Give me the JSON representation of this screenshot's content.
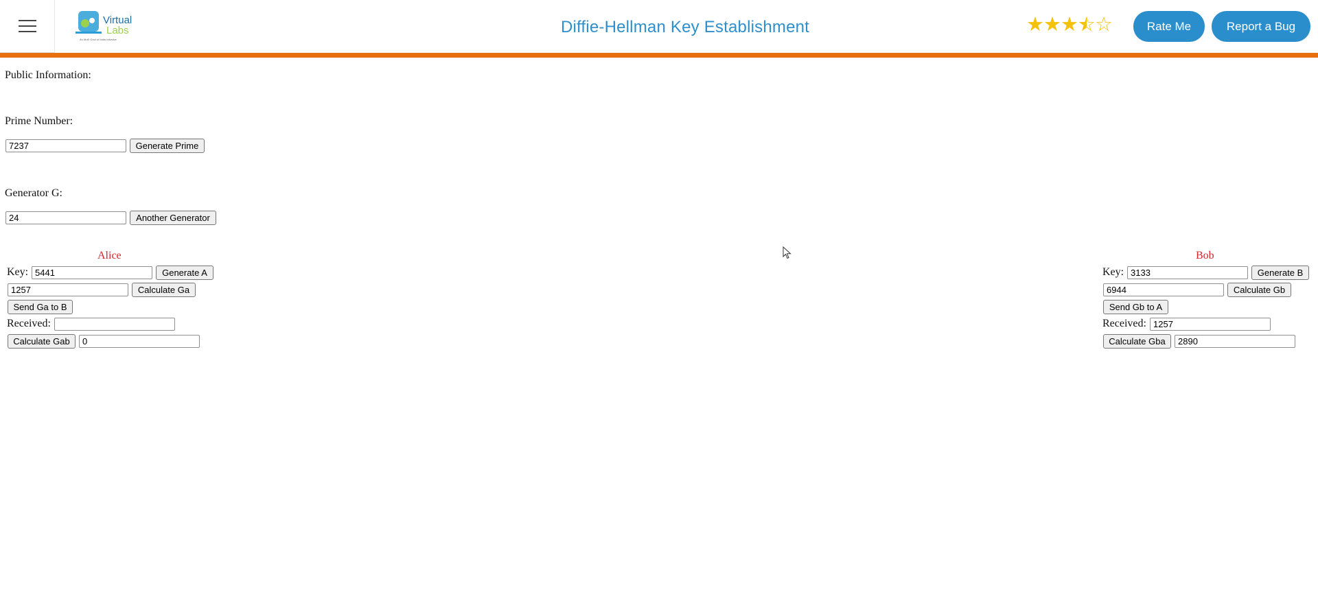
{
  "header": {
    "title": "Diffie-Hellman Key Establishment",
    "logo_line1": "Virtual",
    "logo_line2": "Labs",
    "logo_tagline": "An MoE Govt of India Initiative",
    "rating": 3.5,
    "rating_max": 5,
    "rate_label": "Rate Me",
    "bug_label": "Report a Bug",
    "accent_color": "#2e8fcc",
    "bar_color": "#e8710f"
  },
  "public": {
    "heading": "Public Information:",
    "prime_label": "Prime Number:",
    "prime_value": "7237",
    "prime_button": "Generate Prime",
    "generator_label": "Generator G:",
    "generator_value": "24",
    "generator_button": "Another Generator"
  },
  "alice": {
    "name": "Alice",
    "key_label": "Key:",
    "key_value": "5441",
    "generate_button": "Generate A",
    "g_value": "1257",
    "calc_button": "Calculate Ga",
    "send_button": "Send Ga to B",
    "received_label": "Received:",
    "received_value": "",
    "shared_button": "Calculate Gab",
    "shared_value": "0"
  },
  "bob": {
    "name": "Bob",
    "key_label": "Key:",
    "key_value": "3133",
    "generate_button": "Generate B",
    "g_value": "6944",
    "calc_button": "Calculate Gb",
    "send_button": "Send Gb to A",
    "received_label": "Received:",
    "received_value": "1257",
    "shared_button": "Calculate Gba",
    "shared_value": "2890"
  }
}
